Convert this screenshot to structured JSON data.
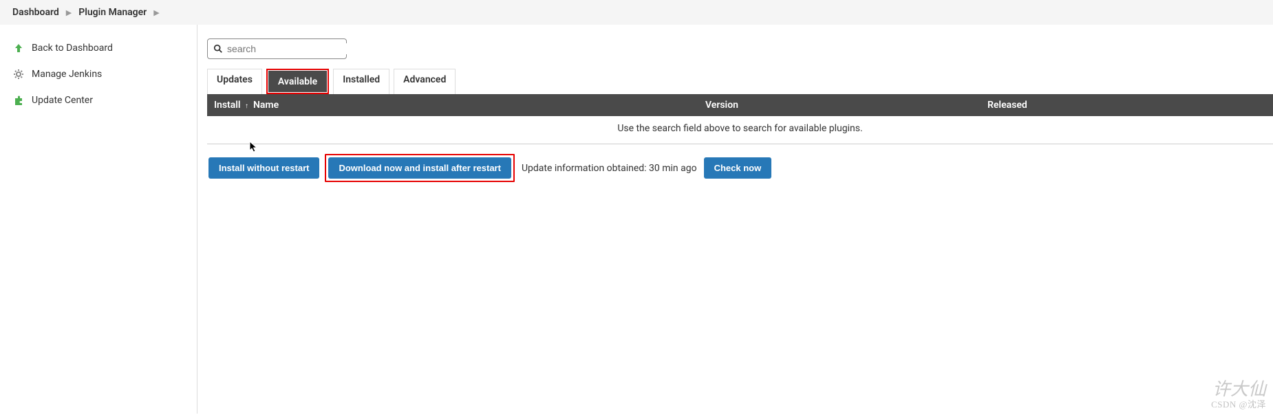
{
  "breadcrumb": {
    "items": [
      "Dashboard",
      "Plugin Manager"
    ]
  },
  "sidebar": {
    "items": [
      {
        "label": "Back to Dashboard",
        "icon": "arrow-up"
      },
      {
        "label": "Manage Jenkins",
        "icon": "gear"
      },
      {
        "label": "Update Center",
        "icon": "puzzle"
      }
    ]
  },
  "search": {
    "placeholder": "search",
    "value": ""
  },
  "tabs": {
    "items": [
      "Updates",
      "Available",
      "Installed",
      "Advanced"
    ],
    "active": "Available"
  },
  "table": {
    "columns": {
      "install": "Install",
      "name": "Name",
      "version": "Version",
      "released": "Released"
    },
    "sort_indicator": "↑",
    "empty_message": "Use the search field above to search for available plugins."
  },
  "actions": {
    "install_without_restart": "Install without restart",
    "download_install_after_restart": "Download now and install after restart",
    "update_info": "Update information obtained: 30 min ago",
    "check_now": "Check now"
  },
  "watermark": {
    "main": "许大仙",
    "sub": "CSDN @沈泽"
  }
}
